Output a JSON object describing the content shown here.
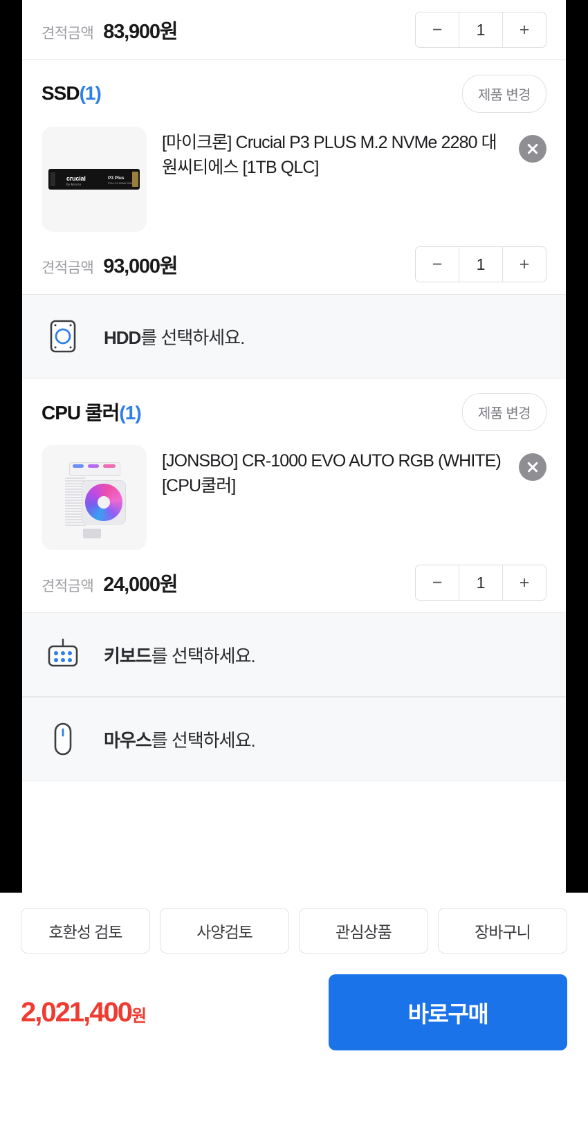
{
  "colors": {
    "accent_blue": "#2f7fe8",
    "buy_button": "#1a73e8",
    "total_price": "#ef3b30",
    "muted_text": "#9b9ba1"
  },
  "top_partial_row": {
    "price_label": "견적금액",
    "price_value": "83,900원",
    "stepper": {
      "minus": "−",
      "qty": "1",
      "plus": "+"
    }
  },
  "sections": [
    {
      "title": "SSD",
      "count": "(1)",
      "change_label": "제품 변경",
      "product_name": "[마이크론] Crucial P3 PLUS M.2 NVMe 2280 대원씨티에스 [1TB QLC]",
      "thumb_alt": "crucial-p3-plus-m2-ssd",
      "price_label": "견적금액",
      "price_value": "93,000원",
      "stepper": {
        "minus": "−",
        "qty": "1",
        "plus": "+"
      },
      "brand_text": "crucial",
      "brand_sub": "by Micron",
      "model_text": "P3 Plus",
      "model_sub": "PCIe 4.0 NVMe SSD"
    },
    {
      "title": "CPU 쿨러",
      "count": "(1)",
      "change_label": "제품 변경",
      "product_name": "[JONSBO] CR-1000 EVO AUTO RGB (WHITE) [CPU쿨러]",
      "thumb_alt": "jonsbo-cr1000-evo-cpu-cooler",
      "price_label": "견적금액",
      "price_value": "24,000원",
      "stepper": {
        "minus": "−",
        "qty": "1",
        "plus": "+"
      }
    }
  ],
  "empty_slots": [
    {
      "name": "HDD",
      "suffix": "를 선택하세요.",
      "icon": "hdd-icon"
    },
    {
      "name": "키보드",
      "suffix": "를 선택하세요.",
      "icon": "keyboard-icon"
    },
    {
      "name": "마우스",
      "suffix": "를 선택하세요.",
      "icon": "mouse-icon"
    }
  ],
  "bottom_bar": {
    "quick_actions": [
      {
        "label": "호환성 검토",
        "name": "compatibility-check"
      },
      {
        "label": "사양검토",
        "name": "spec-review"
      },
      {
        "label": "관심상품",
        "name": "wishlist"
      },
      {
        "label": "장바구니",
        "name": "cart"
      }
    ],
    "total_amount": "2,021,400",
    "total_unit": "원",
    "buy_label": "바로구매"
  }
}
